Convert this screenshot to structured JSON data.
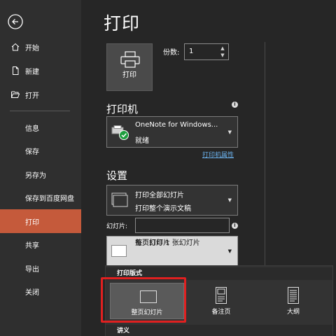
{
  "page_title": "打印",
  "sidebar": {
    "items": [
      {
        "label": "开始",
        "icon": "home-icon"
      },
      {
        "label": "新建",
        "icon": "new-document-icon"
      },
      {
        "label": "打开",
        "icon": "folder-open-icon"
      },
      {
        "label": "信息"
      },
      {
        "label": "保存"
      },
      {
        "label": "另存为"
      },
      {
        "label": "保存到百度网盘"
      },
      {
        "label": "打印",
        "active": true
      },
      {
        "label": "共享"
      },
      {
        "label": "导出"
      },
      {
        "label": "关闭"
      }
    ]
  },
  "print_button": {
    "label": "打印"
  },
  "copies": {
    "label": "份数:",
    "value": "1"
  },
  "printer": {
    "section_title": "打印机",
    "name": "OneNote for Windows...",
    "status": "就绪",
    "properties_link": "打印机属性"
  },
  "settings": {
    "section_title": "设置",
    "slides_range": {
      "line1": "打印全部幻灯片",
      "line2": "打印整个演示文稿"
    },
    "slides_label": "幻灯片:",
    "slides_value": "",
    "layout": {
      "line1": "整页幻灯片",
      "line2": "每页打印 1 张幻灯片"
    }
  },
  "layout_popup": {
    "header": "打印版式",
    "options": [
      {
        "label": "整页幻灯片",
        "selected": true
      },
      {
        "label": "备注页"
      },
      {
        "label": "大纲"
      }
    ],
    "handouts_header": "讲义"
  },
  "colors": {
    "accent": "#c55a3b",
    "highlight": "#e02020",
    "link": "#6cb4f0"
  }
}
